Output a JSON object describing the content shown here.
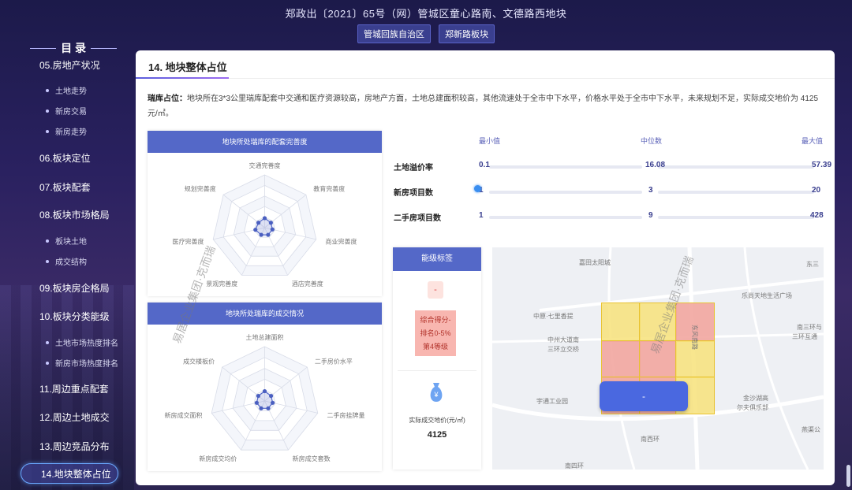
{
  "header": {
    "title": "郑政出〔2021〕65号（网）管城区童心路南、文德路西地块",
    "tags": [
      "管城回族自治区",
      "郑新路板块"
    ]
  },
  "toc": {
    "title": "目 录",
    "items": [
      {
        "label": "05.房地产状况",
        "type": "main"
      },
      {
        "label": "土地走势",
        "type": "sub"
      },
      {
        "label": "新房交易",
        "type": "sub"
      },
      {
        "label": "新房走势",
        "type": "sub"
      },
      {
        "label": "06.板块定位",
        "type": "main"
      },
      {
        "label": "07.板块配套",
        "type": "main"
      },
      {
        "label": "08.板块市场格局",
        "type": "main"
      },
      {
        "label": "板块土地",
        "type": "sub"
      },
      {
        "label": "成交结构",
        "type": "sub"
      },
      {
        "label": "09.板块房企格局",
        "type": "main"
      },
      {
        "label": "10.板块分类能级",
        "type": "main"
      },
      {
        "label": "土地市场热度排名",
        "type": "sub"
      },
      {
        "label": "新房市场热度排名",
        "type": "sub"
      },
      {
        "label": "11.周边重点配套",
        "type": "main"
      },
      {
        "label": "12.周边土地成交",
        "type": "main"
      },
      {
        "label": "13.周边竞品分布",
        "type": "main"
      },
      {
        "label": "14.地块整体占位",
        "type": "active"
      }
    ]
  },
  "card": {
    "title": "14. 地块整体占位",
    "desc_label": "瑞库占位：",
    "desc_text": "地块所在3*3公里瑞库配套中交通和医疗资源较高，房地产方面，土地总建面积较高，其他流速处于全市中下水平，价格水平处于全市中下水平，未来规划不足，实际成交地价为 4125元/㎡。"
  },
  "radar1": {
    "title": "地块所处瑞库的配套完善度",
    "axes": [
      "交通完善度",
      "教育完善度",
      "商业完善度",
      "酒店完善度",
      "景观完善度",
      "医疗完善度",
      "规划完善度"
    ],
    "values": [
      0.18,
      0.15,
      0.15,
      0.15,
      0.15,
      0.18,
      0.15
    ]
  },
  "radar2": {
    "title": "地块所处瑞库的成交情况",
    "axes": [
      "土地总建面积",
      "二手房价水平",
      "二手房挂牌量",
      "新房成交套数",
      "新房成交均价",
      "新房成交面积",
      "成交楼板价"
    ],
    "values": [
      0.18,
      0.15,
      0.15,
      0.15,
      0.15,
      0.15,
      0.15
    ]
  },
  "scale": {
    "min_label": "最小值",
    "mid_label": "中位数",
    "max_label": "最大值",
    "rows": [
      {
        "label": "土地溢价率",
        "min": "0.1",
        "mid": "16.08",
        "max": "57.39"
      },
      {
        "label": "新房项目数",
        "min": "1",
        "mid": "3",
        "max": "20"
      },
      {
        "label": "二手房项目数",
        "min": "1",
        "mid": "9",
        "max": "428"
      }
    ]
  },
  "badge": {
    "title": "能级标签",
    "dash": "-",
    "score_lines": [
      "综合得分-",
      "排名0-5%",
      "第4等级"
    ],
    "price_label": "实际成交地价(元/㎡)",
    "price_value": "4125",
    "money_icon": "money-bag-icon"
  },
  "map": {
    "labels": [
      "嘉田太阳城",
      "中原·七里香提",
      "中州大道南",
      "三环立交桥",
      "东风南路",
      "东三",
      "乐尚天地生活广场",
      "南三环与",
      "三环互通",
      "宇通工业园",
      "金沙湖高",
      "尔夫俱乐部",
      "南西环",
      "南四环",
      "燕渠公"
    ],
    "button_label": "-"
  },
  "watermark": {
    "text": "易居企业集团·克而瑞"
  },
  "colors": {
    "accent": "#5468c8",
    "primary_button": "#4a68e0",
    "badge_red": "#f8b6b0",
    "map_yellow": "#f7e27a",
    "map_red": "#f2a6a0"
  }
}
